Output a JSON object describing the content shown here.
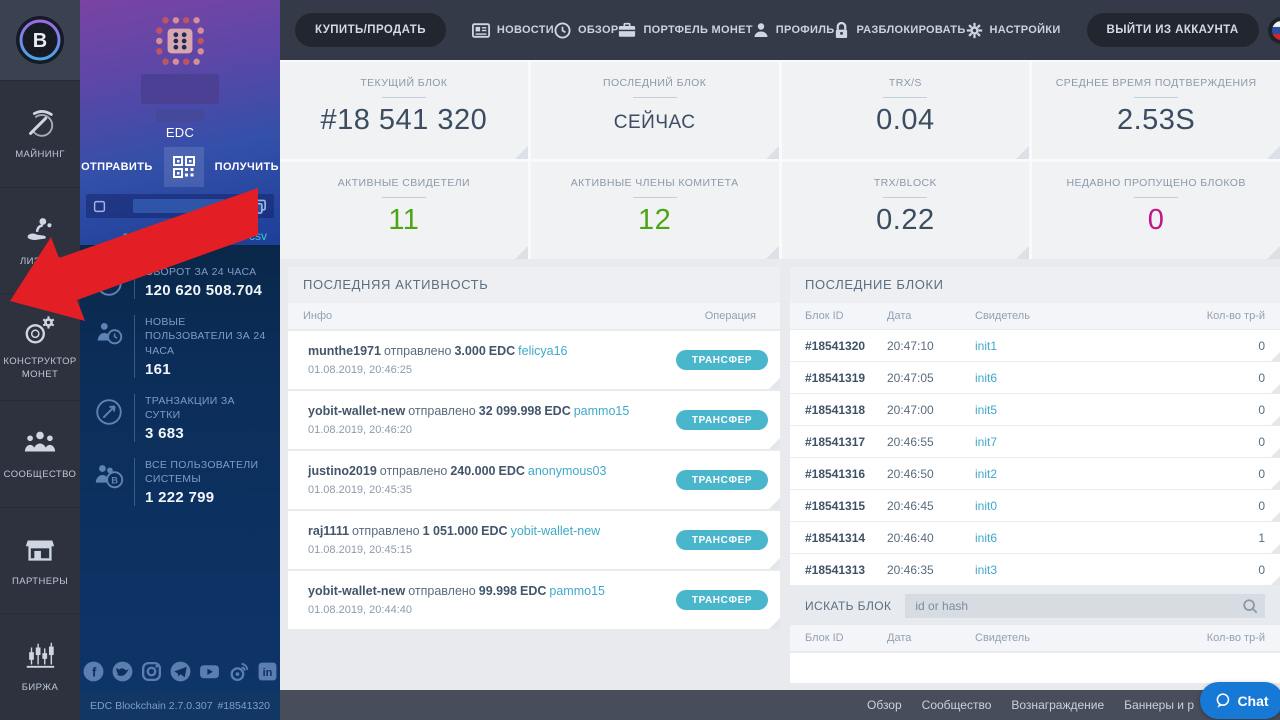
{
  "topnav": {
    "buy_sell_label": "КУПИТЬ/ПРОДАТЬ",
    "items": [
      {
        "label": "НОВОСТИ",
        "icon": "news-icon"
      },
      {
        "label": "ОБЗОР",
        "icon": "overview-clock-icon"
      },
      {
        "label": "ПОРТФЕЛЬ МОНЕТ",
        "icon": "portfolio-briefcase-icon"
      },
      {
        "label": "ПРОФИЛЬ",
        "icon": "profile-person-icon"
      },
      {
        "label": "РАЗБЛОКИРОВАТЬ",
        "icon": "unlock-padlock-icon"
      },
      {
        "label": "НАСТРОЙКИ",
        "icon": "settings-gear-icon"
      }
    ],
    "logout_label": "ВЫЙТИ ИЗ АККАУНТА",
    "language_flag": "russian-flag"
  },
  "sidebar": {
    "items": [
      {
        "label": "МАЙНИНГ",
        "icon": "pickaxe-mining-icon"
      },
      {
        "label": "ЛИЗИНГ",
        "icon": "leasing-hand-icon"
      },
      {
        "label": "КОНСТРУКТОР МОНЕТ",
        "icon": "coin-constructor-icon"
      },
      {
        "label": "СООБЩЕСТВО",
        "icon": "community-people-icon"
      },
      {
        "label": "ПАРТНЕРЫ",
        "icon": "partners-store-icon"
      },
      {
        "label": "БИРЖА",
        "icon": "exchange-candles-icon"
      }
    ]
  },
  "wallet": {
    "currency": "EDC",
    "send_label": "ОТПРАВИТЬ",
    "receive_label": "ПОЛУЧИТЬ",
    "csv_link": "ать полную историю в csv",
    "stats": [
      {
        "label": "ОБОРОТ ЗА 24 ЧАСА",
        "value": "120 620 508.704",
        "icon": "turnover-icon"
      },
      {
        "label": "НОВЫЕ ПОЛЬЗОВАТЕЛИ ЗА 24 ЧАСА",
        "value": "161",
        "icon": "new-users-icon"
      },
      {
        "label": "ТРАНЗАКЦИИ ЗА СУТКИ",
        "value": "3 683",
        "icon": "transactions-icon"
      },
      {
        "label": "ВСЕ ПОЛЬЗОВАТЕЛИ СИСТЕМЫ",
        "value": "1 222 799",
        "icon": "all-users-icon"
      }
    ],
    "social": [
      "facebook",
      "twitter",
      "instagram",
      "telegram",
      "youtube",
      "weibo",
      "linkedin"
    ],
    "footer_version": "EDC Blockchain 2.7.0.307",
    "footer_block": "#18541320"
  },
  "cards": [
    {
      "label": "ТЕКУЩИЙ БЛОК",
      "value": "#18 541 320"
    },
    {
      "label": "ПОСЛЕДНИЙ БЛОК",
      "value": "СЕЙЧАС"
    },
    {
      "label": "TRX/S",
      "value": "0.04"
    },
    {
      "label": "СРЕДНЕЕ ВРЕМЯ ПОДТВЕРЖДЕНИЯ",
      "value": "2.53S"
    },
    {
      "label": "АКТИВНЫЕ СВИДЕТЕЛИ",
      "value": "11"
    },
    {
      "label": "АКТИВНЫЕ ЧЛЕНЫ КОМИТЕТА",
      "value": "12"
    },
    {
      "label": "TRX/BLOCK",
      "value": "0.22"
    },
    {
      "label": "НЕДАВНО ПРОПУЩЕНО БЛОКОВ",
      "value": "0"
    }
  ],
  "activity": {
    "title": "ПОСЛЕДНЯЯ АКТИВНОСТЬ",
    "col_info": "Инфо",
    "col_op": "Операция",
    "rows": [
      {
        "sender": "munthe1971",
        "action": "отправлено",
        "amount": "3.000",
        "currency": "EDC",
        "recipient": "felicya16",
        "time": "01.08.2019, 20:46:25",
        "op": "ТРАНСФЕР"
      },
      {
        "sender": "yobit-wallet-new",
        "action": "отправлено",
        "amount": "32 099.998",
        "currency": "EDC",
        "recipient": "pammo15",
        "time": "01.08.2019, 20:46:20",
        "op": "ТРАНСФЕР"
      },
      {
        "sender": "justino2019",
        "action": "отправлено",
        "amount": "240.000",
        "currency": "EDC",
        "recipient": "anonymous03",
        "time": "01.08.2019, 20:45:35",
        "op": "ТРАНСФЕР"
      },
      {
        "sender": "raj1111",
        "action": "отправлено",
        "amount": "1 051.000",
        "currency": "EDC",
        "recipient": "yobit-wallet-new",
        "time": "01.08.2019, 20:45:15",
        "op": "ТРАНСФЕР"
      },
      {
        "sender": "yobit-wallet-new",
        "action": "отправлено",
        "amount": "99.998",
        "currency": "EDC",
        "recipient": "pammo15",
        "time": "01.08.2019, 20:44:40",
        "op": "ТРАНСФЕР"
      }
    ]
  },
  "blocks": {
    "title": "ПОСЛЕДНИЕ БЛОКИ",
    "cols": [
      "Блок ID",
      "Дата",
      "Свидетель",
      "Кол-во тр-й"
    ],
    "rows": [
      {
        "id": "#18541320",
        "date": "20:47:10",
        "witness": "init1",
        "txs": "0"
      },
      {
        "id": "#18541319",
        "date": "20:47:05",
        "witness": "init6",
        "txs": "0"
      },
      {
        "id": "#18541318",
        "date": "20:47:00",
        "witness": "init5",
        "txs": "0"
      },
      {
        "id": "#18541317",
        "date": "20:46:55",
        "witness": "init7",
        "txs": "0"
      },
      {
        "id": "#18541316",
        "date": "20:46:50",
        "witness": "init2",
        "txs": "0"
      },
      {
        "id": "#18541315",
        "date": "20:46:45",
        "witness": "init0",
        "txs": "0"
      },
      {
        "id": "#18541314",
        "date": "20:46:40",
        "witness": "init6",
        "txs": "1"
      },
      {
        "id": "#18541313",
        "date": "20:46:35",
        "witness": "init3",
        "txs": "0"
      }
    ],
    "search_label": "ИСКАТЬ БЛОК",
    "search_placeholder": "id or hash"
  },
  "page_footer": {
    "links": [
      "Обзор",
      "Сообщество",
      "Вознаграждение",
      "Баннеры и р"
    ]
  },
  "chat": {
    "label": "Chat"
  },
  "colors": {
    "accent_teal": "#4ab6cc",
    "link_teal": "#3fa9c9",
    "green": "#4ea512",
    "magenta": "#c01687",
    "chat_blue": "#1779d6",
    "arrow_red": "#e31e24",
    "panel_navy": "#0d3263",
    "panel_purple": "#7a44a4",
    "nav_dark": "#343a47"
  }
}
